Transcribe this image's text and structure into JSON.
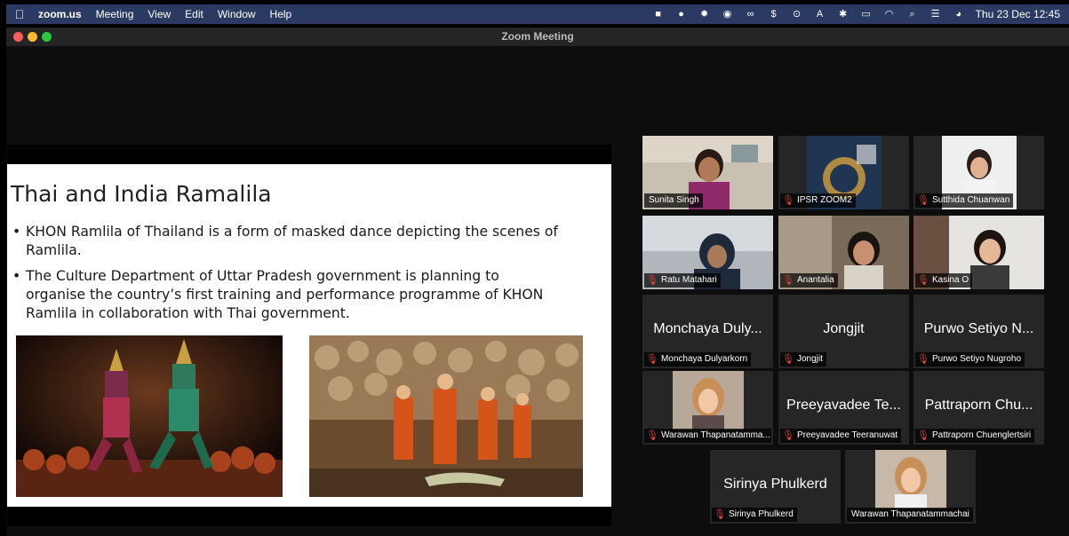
{
  "menubar": {
    "apple_icon": "apple-icon",
    "app": "zoom.us",
    "items": [
      "Meeting",
      "View",
      "Edit",
      "Window",
      "Help"
    ],
    "status_icons": [
      "zoom-icon",
      "chat-icon",
      "settings-icon",
      "camera-icon",
      "infinity-icon",
      "dollar-icon",
      "play-icon",
      "a-icon",
      "bluetooth-icon",
      "battery-icon",
      "wifi-icon",
      "search-icon",
      "control-center-icon",
      "siri-icon"
    ],
    "status_glyphs": [
      "■",
      "●",
      "✹",
      "◉",
      "∞",
      "$",
      "⊙",
      "A",
      "✱",
      "▭",
      "◠",
      "⌕",
      "☰",
      "◕"
    ],
    "clock": "Thu 23 Dec  12:45"
  },
  "window": {
    "title": "Zoom Meeting",
    "colors": {
      "close": "#ff5f57",
      "minimize": "#febc2e",
      "zoom": "#28c840"
    }
  },
  "slide": {
    "title": "Thai and India Ramalila",
    "bullets": [
      "KHON Ramlila of Thailand is a form of masked dance depicting the scenes of Ramlila.",
      "The Culture Department of Uttar Pradesh government is planning to organise the country’s first training and performance programme of KHON Ramlila in collaboration with Thai government."
    ]
  },
  "gallery": {
    "accent": "#d9e35a",
    "muted_color": "#e0463c",
    "tiles": [
      {
        "label": "Sunita Singh",
        "muted": false,
        "video": true,
        "active": true
      },
      {
        "label": "IPSR ZOOM2",
        "muted": true,
        "video": true,
        "active": false
      },
      {
        "label": "Sutthida Chuanwan",
        "muted": true,
        "video": true,
        "active": false
      },
      {
        "label": "Ratu Matahari",
        "muted": true,
        "video": true,
        "active": false
      },
      {
        "label": "Anantalia",
        "muted": true,
        "video": true,
        "active": false
      },
      {
        "label": "Kasina O",
        "muted": true,
        "video": true,
        "active": false
      },
      {
        "label": "Monchaya Dulyarkorn",
        "display": "Monchaya Duly...",
        "muted": true,
        "video": false
      },
      {
        "label": "Jongjit",
        "display": "Jongjit",
        "muted": true,
        "video": false
      },
      {
        "label": "Purwo Setiyo Nugroho",
        "display": "Purwo Setiyo N...",
        "muted": true,
        "video": false
      },
      {
        "label": "Warawan Thapanatamma...",
        "muted": true,
        "video": true
      },
      {
        "label": "Preeyavadee Teeranuwat",
        "display": "Preeyavadee Te...",
        "muted": true,
        "video": false
      },
      {
        "label": "Pattraporn Chuenglertsiri",
        "display": "Pattraporn Chu...",
        "muted": true,
        "video": false
      },
      {
        "label": "Sirinya Phulkerd",
        "display": "Sirinya Phulkerd",
        "muted": true,
        "video": false
      },
      {
        "label": "Warawan Thapanatammachai",
        "muted": false,
        "video": true
      }
    ]
  }
}
